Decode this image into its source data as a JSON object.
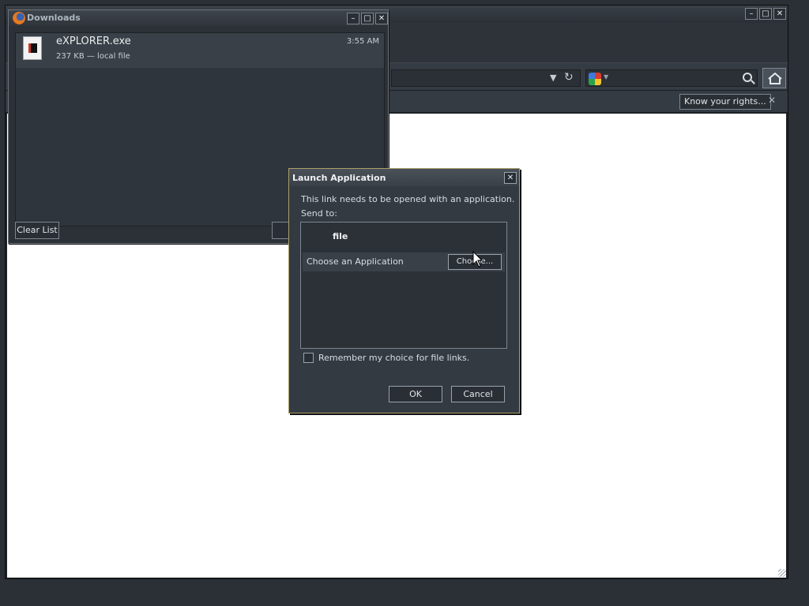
{
  "browser": {
    "notification": {
      "button_label": "Know your rights..."
    },
    "icons": {
      "search": "google-search-icon",
      "home": "home-icon"
    }
  },
  "downloads_window": {
    "title": "Downloads",
    "items": [
      {
        "name": "eXPLORER.exe",
        "meta": "237 KB — local file",
        "time": "3:55 AM"
      }
    ],
    "clear_label": "Clear List"
  },
  "launch_dialog": {
    "title": "Launch Application",
    "message": "This link needs to be opened with an application.",
    "send_to_label": "Send to:",
    "list_header": "file",
    "choose_row_label": "Choose an Application",
    "choose_button": "Choose...",
    "remember_label": "Remember my choice for file links.",
    "remember_checked": false,
    "ok": "OK",
    "cancel": "Cancel"
  }
}
